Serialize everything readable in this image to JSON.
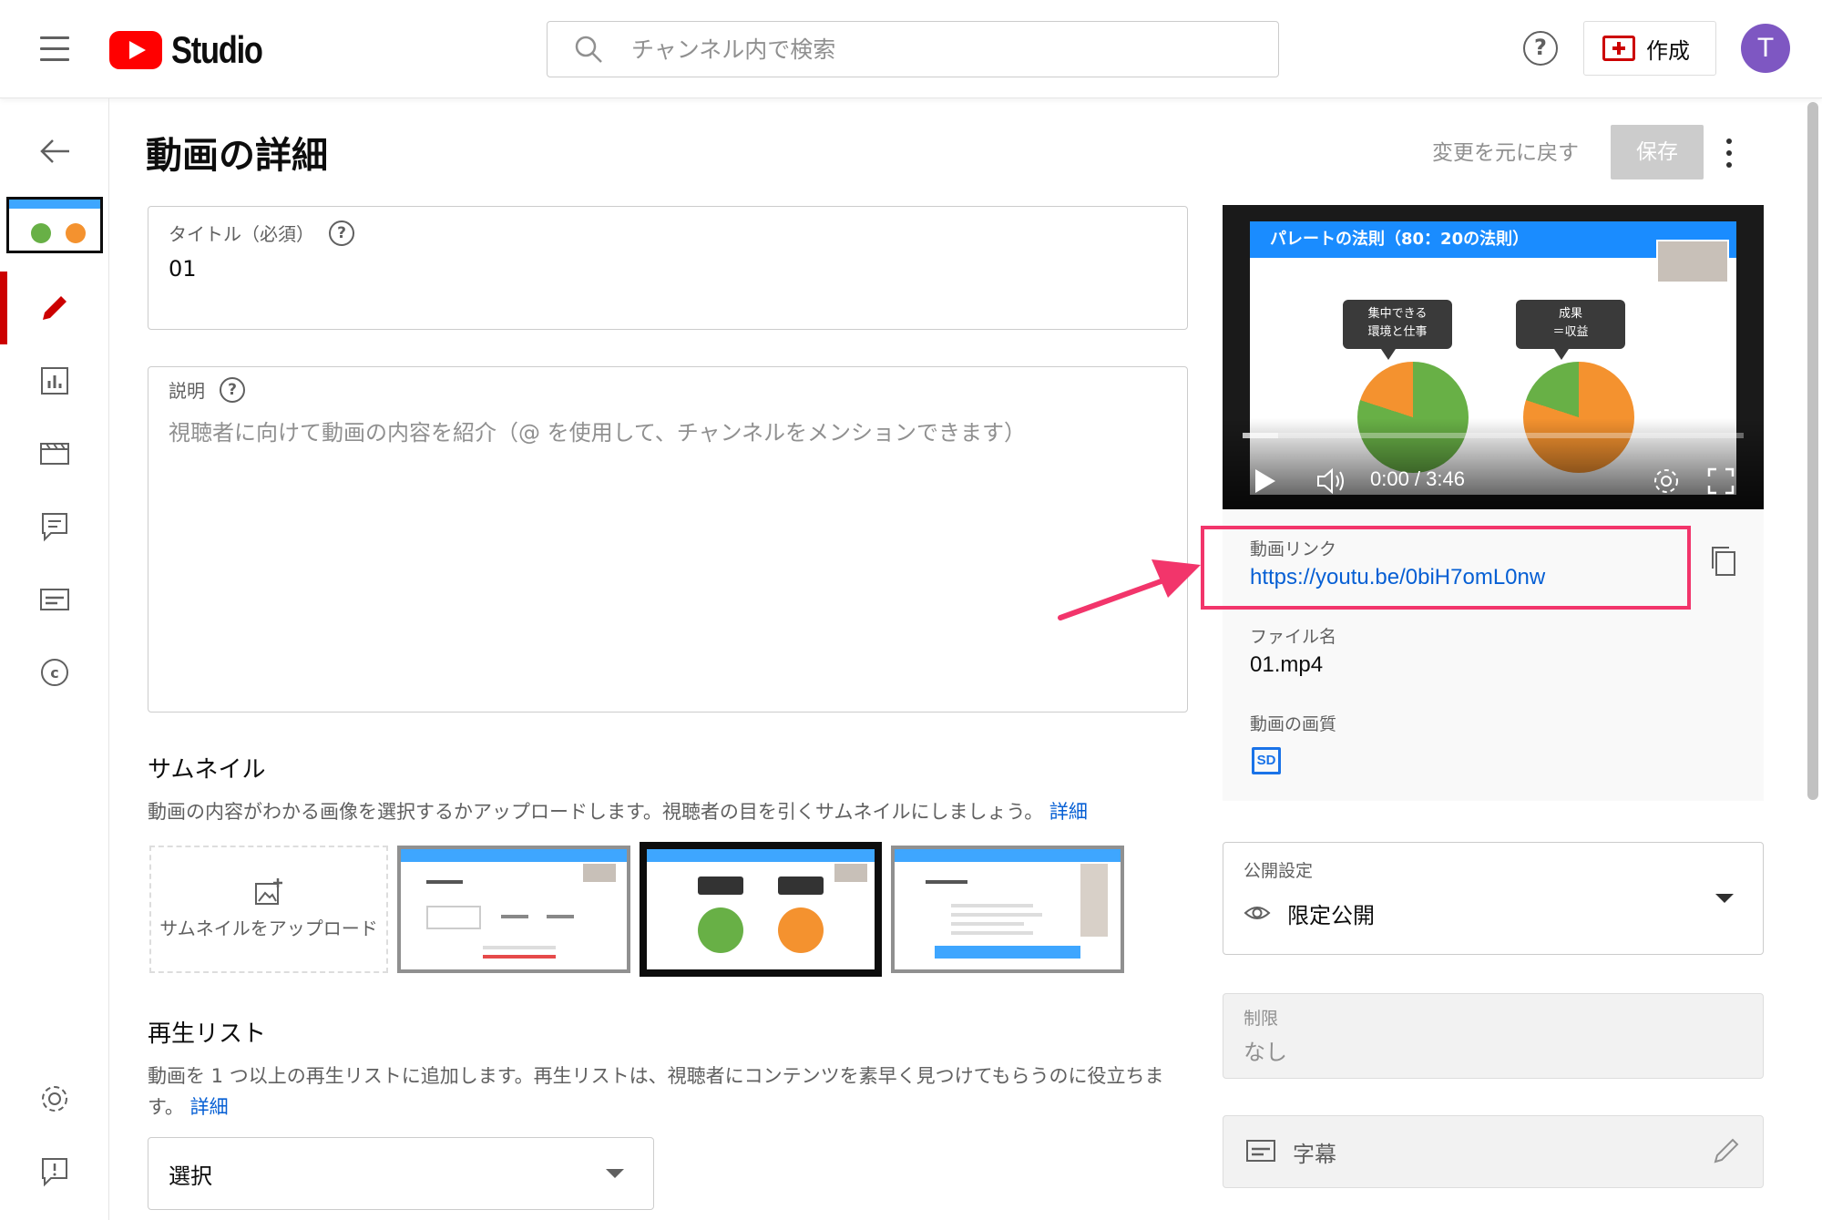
{
  "header": {
    "logo_text": "Studio",
    "search_placeholder": "チャンネル内で検索",
    "help_label": "?",
    "create_label": "作成",
    "avatar_letter": "T"
  },
  "page": {
    "title": "動画の詳細",
    "revert_label": "変更を元に戻す",
    "save_label": "保存"
  },
  "form": {
    "title_label": "タイトル（必須）",
    "title_value": "01",
    "description_label": "説明",
    "description_placeholder": "視聴者に向けて動画の内容を紹介（@ を使用して、チャンネルをメンションできます）",
    "help_glyph": "?"
  },
  "thumbnail": {
    "heading": "サムネイル",
    "description": "動画の内容がわかる画像を選択するかアップロードします。視聴者の目を引くサムネイルにしましょう。",
    "details_link": "詳細",
    "upload_label": "サムネイルをアップロード"
  },
  "playlist": {
    "heading": "再生リスト",
    "description": "動画を 1 つ以上の再生リストに追加します。再生リストは、視聴者にコンテンツを素早く見つけてもらうのに役立ちます。",
    "details_link": "詳細",
    "select_label": "選択"
  },
  "video": {
    "slide_title": "パレートの法則（80：20の法則）",
    "bubble_left": "集中できる\n環境と仕事",
    "bubble_right": "成果\n＝収益",
    "time": "0:00 / 3:46",
    "progress_fraction": 0.07
  },
  "info": {
    "link_label": "動画リンク",
    "link_url": "https://youtu.be/0biH7omL0nw",
    "file_label": "ファイル名",
    "file_value": "01.mp4",
    "quality_label": "動画の画質",
    "quality_badge": "SD"
  },
  "visibility": {
    "label": "公開設定",
    "value": "限定公開"
  },
  "restrictions": {
    "label": "制限",
    "value": "なし"
  },
  "subtitles": {
    "label": "字幕"
  },
  "colors": {
    "accent_red": "#cc0000",
    "link_blue": "#065fd4",
    "highlight_pink": "#f2356b",
    "pie_green": "#68b046",
    "pie_orange": "#f4922f"
  },
  "icons": [
    "menu-icon",
    "search-icon",
    "help-icon",
    "create-icon",
    "back-icon",
    "edit-icon",
    "analytics-icon",
    "editor-icon",
    "comments-icon",
    "subtitles-icon",
    "copyright-icon",
    "settings-icon",
    "feedback-icon",
    "copy-icon",
    "eye-icon",
    "pencil-icon",
    "play-icon",
    "volume-icon",
    "gear-icon",
    "fullscreen-icon",
    "image-plus-icon"
  ]
}
